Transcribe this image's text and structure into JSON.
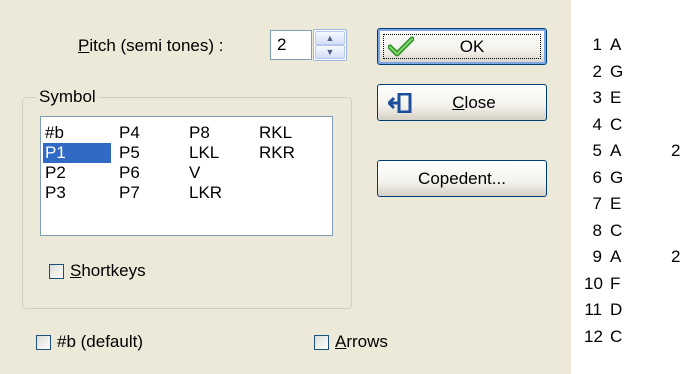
{
  "pitch": {
    "label_accel": "P",
    "label_rest": "itch (semi tones) :",
    "value": "2",
    "spin_up_icon": "triangle-up",
    "spin_down_icon": "triangle-down"
  },
  "symbol_group": {
    "title": "Symbol",
    "list": {
      "columns": [
        [
          "#b",
          "P1",
          "P2",
          "P3"
        ],
        [
          "P4",
          "P5",
          "P6",
          "P7"
        ],
        [
          "P8",
          "LKL",
          "V",
          "LKR"
        ],
        [
          "RKL",
          "RKR",
          "",
          ""
        ]
      ],
      "selected": "P1"
    },
    "shortkeys": {
      "label_accel": "S",
      "label_rest": "hortkeys",
      "checked": false
    }
  },
  "options": {
    "sharp_default": {
      "label": "#b (default)",
      "checked": false
    },
    "arrows": {
      "label_accel": "A",
      "label_rest": "rrows",
      "checked": false
    }
  },
  "buttons": {
    "ok": {
      "label": "OK",
      "icon": "checkmark-icon",
      "icon_color": "#3aa12c"
    },
    "close": {
      "label_accel": "C",
      "label_rest": "lose",
      "icon": "exit-door-icon",
      "icon_color": "#1d4f9c"
    },
    "copedent": {
      "label": "Copedent..."
    }
  },
  "tuning": {
    "rows": [
      {
        "num": "1",
        "note": "A",
        "extra": ""
      },
      {
        "num": "2",
        "note": "G",
        "extra": ""
      },
      {
        "num": "3",
        "note": "E",
        "extra": ""
      },
      {
        "num": "4",
        "note": "C",
        "extra": ""
      },
      {
        "num": "5",
        "note": "A",
        "extra": "2"
      },
      {
        "num": "6",
        "note": "G",
        "extra": ""
      },
      {
        "num": "7",
        "note": "E",
        "extra": ""
      },
      {
        "num": "8",
        "note": "C",
        "extra": ""
      },
      {
        "num": "9",
        "note": "A",
        "extra": "2"
      },
      {
        "num": "10",
        "note": "F",
        "extra": ""
      },
      {
        "num": "11",
        "note": "D",
        "extra": ""
      },
      {
        "num": "12",
        "note": "C",
        "extra": ""
      }
    ]
  },
  "colors": {
    "dialog_bg": "#ece9d8",
    "selection": "#316ac5",
    "button_border": "#003c74"
  }
}
